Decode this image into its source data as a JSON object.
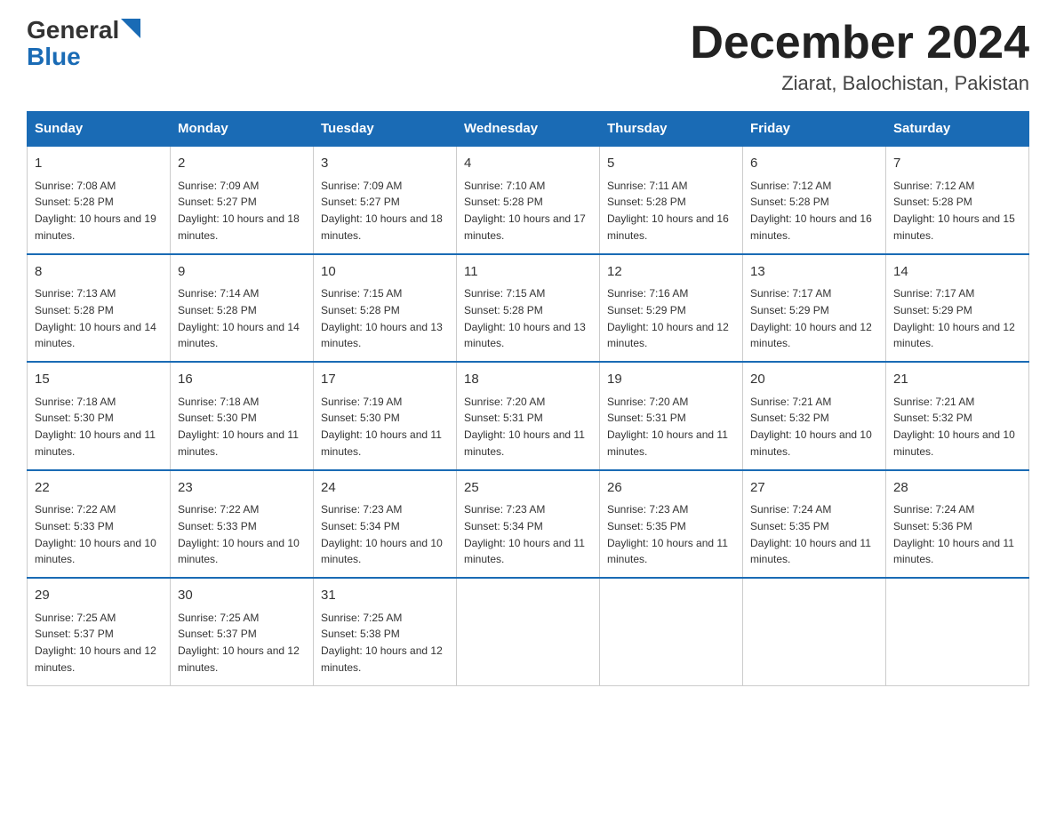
{
  "logo": {
    "general": "General",
    "blue": "Blue"
  },
  "header": {
    "month": "December 2024",
    "location": "Ziarat, Balochistan, Pakistan"
  },
  "days_of_week": [
    "Sunday",
    "Monday",
    "Tuesday",
    "Wednesday",
    "Thursday",
    "Friday",
    "Saturday"
  ],
  "weeks": [
    [
      {
        "day": "1",
        "sunrise": "7:08 AM",
        "sunset": "5:28 PM",
        "daylight": "10 hours and 19 minutes."
      },
      {
        "day": "2",
        "sunrise": "7:09 AM",
        "sunset": "5:27 PM",
        "daylight": "10 hours and 18 minutes."
      },
      {
        "day": "3",
        "sunrise": "7:09 AM",
        "sunset": "5:27 PM",
        "daylight": "10 hours and 18 minutes."
      },
      {
        "day": "4",
        "sunrise": "7:10 AM",
        "sunset": "5:28 PM",
        "daylight": "10 hours and 17 minutes."
      },
      {
        "day": "5",
        "sunrise": "7:11 AM",
        "sunset": "5:28 PM",
        "daylight": "10 hours and 16 minutes."
      },
      {
        "day": "6",
        "sunrise": "7:12 AM",
        "sunset": "5:28 PM",
        "daylight": "10 hours and 16 minutes."
      },
      {
        "day": "7",
        "sunrise": "7:12 AM",
        "sunset": "5:28 PM",
        "daylight": "10 hours and 15 minutes."
      }
    ],
    [
      {
        "day": "8",
        "sunrise": "7:13 AM",
        "sunset": "5:28 PM",
        "daylight": "10 hours and 14 minutes."
      },
      {
        "day": "9",
        "sunrise": "7:14 AM",
        "sunset": "5:28 PM",
        "daylight": "10 hours and 14 minutes."
      },
      {
        "day": "10",
        "sunrise": "7:15 AM",
        "sunset": "5:28 PM",
        "daylight": "10 hours and 13 minutes."
      },
      {
        "day": "11",
        "sunrise": "7:15 AM",
        "sunset": "5:28 PM",
        "daylight": "10 hours and 13 minutes."
      },
      {
        "day": "12",
        "sunrise": "7:16 AM",
        "sunset": "5:29 PM",
        "daylight": "10 hours and 12 minutes."
      },
      {
        "day": "13",
        "sunrise": "7:17 AM",
        "sunset": "5:29 PM",
        "daylight": "10 hours and 12 minutes."
      },
      {
        "day": "14",
        "sunrise": "7:17 AM",
        "sunset": "5:29 PM",
        "daylight": "10 hours and 12 minutes."
      }
    ],
    [
      {
        "day": "15",
        "sunrise": "7:18 AM",
        "sunset": "5:30 PM",
        "daylight": "10 hours and 11 minutes."
      },
      {
        "day": "16",
        "sunrise": "7:18 AM",
        "sunset": "5:30 PM",
        "daylight": "10 hours and 11 minutes."
      },
      {
        "day": "17",
        "sunrise": "7:19 AM",
        "sunset": "5:30 PM",
        "daylight": "10 hours and 11 minutes."
      },
      {
        "day": "18",
        "sunrise": "7:20 AM",
        "sunset": "5:31 PM",
        "daylight": "10 hours and 11 minutes."
      },
      {
        "day": "19",
        "sunrise": "7:20 AM",
        "sunset": "5:31 PM",
        "daylight": "10 hours and 11 minutes."
      },
      {
        "day": "20",
        "sunrise": "7:21 AM",
        "sunset": "5:32 PM",
        "daylight": "10 hours and 10 minutes."
      },
      {
        "day": "21",
        "sunrise": "7:21 AM",
        "sunset": "5:32 PM",
        "daylight": "10 hours and 10 minutes."
      }
    ],
    [
      {
        "day": "22",
        "sunrise": "7:22 AM",
        "sunset": "5:33 PM",
        "daylight": "10 hours and 10 minutes."
      },
      {
        "day": "23",
        "sunrise": "7:22 AM",
        "sunset": "5:33 PM",
        "daylight": "10 hours and 10 minutes."
      },
      {
        "day": "24",
        "sunrise": "7:23 AM",
        "sunset": "5:34 PM",
        "daylight": "10 hours and 10 minutes."
      },
      {
        "day": "25",
        "sunrise": "7:23 AM",
        "sunset": "5:34 PM",
        "daylight": "10 hours and 11 minutes."
      },
      {
        "day": "26",
        "sunrise": "7:23 AM",
        "sunset": "5:35 PM",
        "daylight": "10 hours and 11 minutes."
      },
      {
        "day": "27",
        "sunrise": "7:24 AM",
        "sunset": "5:35 PM",
        "daylight": "10 hours and 11 minutes."
      },
      {
        "day": "28",
        "sunrise": "7:24 AM",
        "sunset": "5:36 PM",
        "daylight": "10 hours and 11 minutes."
      }
    ],
    [
      {
        "day": "29",
        "sunrise": "7:25 AM",
        "sunset": "5:37 PM",
        "daylight": "10 hours and 12 minutes."
      },
      {
        "day": "30",
        "sunrise": "7:25 AM",
        "sunset": "5:37 PM",
        "daylight": "10 hours and 12 minutes."
      },
      {
        "day": "31",
        "sunrise": "7:25 AM",
        "sunset": "5:38 PM",
        "daylight": "10 hours and 12 minutes."
      },
      null,
      null,
      null,
      null
    ]
  ]
}
